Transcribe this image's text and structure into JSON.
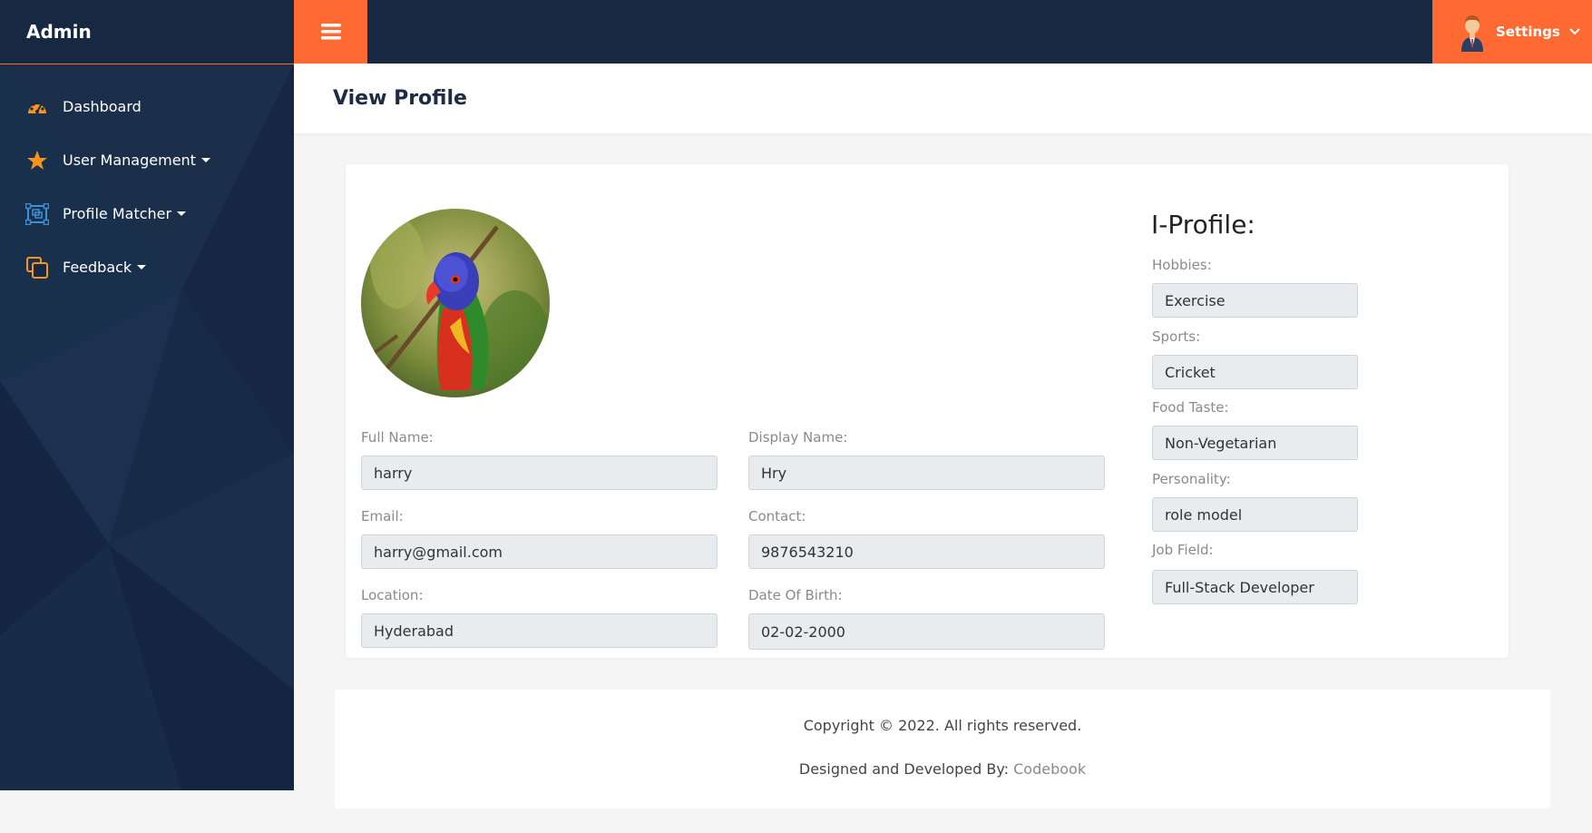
{
  "brand": {
    "title": "Admin"
  },
  "sidebar": {
    "items": [
      {
        "label": "Dashboard",
        "icon": "dashboard-gauge-icon",
        "has_dropdown": false
      },
      {
        "label": "User Management",
        "icon": "star-icon",
        "has_dropdown": true
      },
      {
        "label": "Profile Matcher",
        "icon": "profile-matcher-icon",
        "has_dropdown": true
      },
      {
        "label": "Feedback",
        "icon": "copy-squares-icon",
        "has_dropdown": true
      }
    ]
  },
  "topbar": {
    "menu_icon": "hamburger-icon",
    "settings_label": "Settings",
    "avatar_icon": "user-avatar-icon"
  },
  "page": {
    "title": "View Profile"
  },
  "profile": {
    "photo": "parrot-profile-photo",
    "full_name_label": "Full Name:",
    "full_name_value": "harry",
    "display_name_label": "Display Name:",
    "display_name_value": "Hry",
    "email_label": "Email:",
    "email_value": "harry@gmail.com",
    "contact_label": "Contact:",
    "contact_value": "9876543210",
    "location_label": "Location:",
    "location_value": "Hyderabad",
    "dob_label": "Date Of Birth:",
    "dob_value": "02-02-2000"
  },
  "iprofile": {
    "title": "I-Profile:",
    "hobbies_label": "Hobbies:",
    "hobbies_value": "Exercise",
    "sports_label": "Sports:",
    "sports_value": "Cricket",
    "food_label": "Food Taste:",
    "food_value": "Non-Vegetarian",
    "personality_label": "Personality:",
    "personality_value": "role model",
    "job_label": "Job Field:",
    "job_value": "Full-Stack Developer"
  },
  "footer": {
    "copyright": "Copyright © 2022. All rights reserved.",
    "designed_by_prefix": "Designed and Developed By: ",
    "designed_by_link": "Codebook"
  },
  "colors": {
    "accent": "#ff6a33",
    "navy": "#172942",
    "icon_orange": "#f7941d",
    "icon_blue": "#3d8fd6"
  }
}
